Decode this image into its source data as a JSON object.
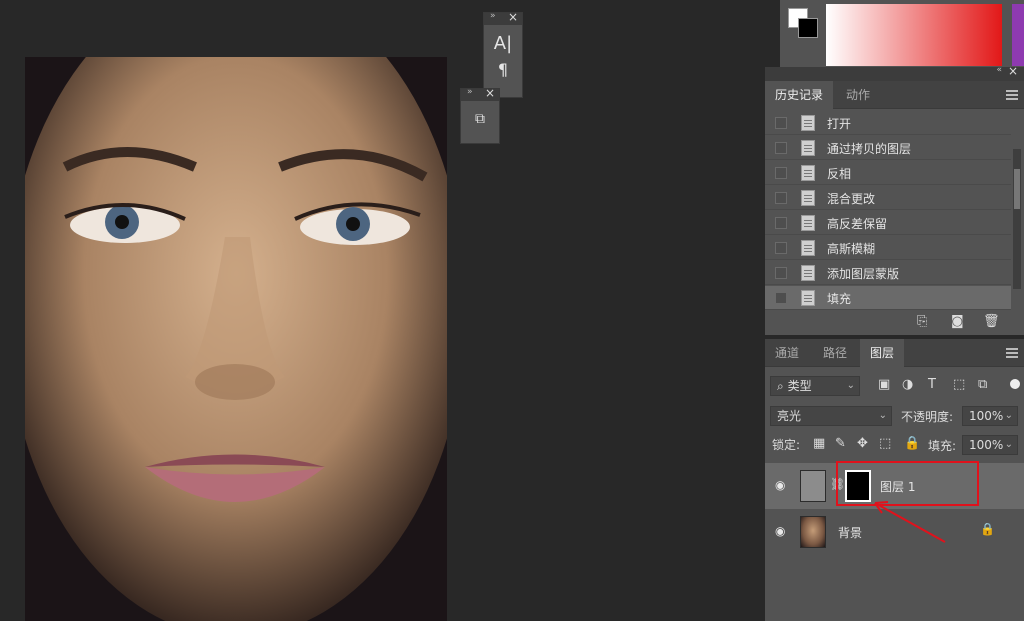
{
  "colors": {
    "background": "#282828",
    "panel": "#535353",
    "annotation": "#e0121c",
    "picker_hue": "#e21818"
  },
  "text_tools": {
    "char_icon": "A|",
    "para_icon": "¶"
  },
  "history_panel": {
    "tabs": [
      "历史记录",
      "动作"
    ],
    "items": [
      "打开",
      "通过拷贝的图层",
      "反相",
      "混合更改",
      "高反差保留",
      "高斯模糊",
      "添加图层蒙版",
      "填充"
    ],
    "icons": [
      "new-snapshot-icon",
      "camera-icon",
      "trash-icon"
    ]
  },
  "layers_panel": {
    "tabs": [
      "通道",
      "路径",
      "图层"
    ],
    "filter_kind": "类型",
    "blend_mode": "亮光",
    "opacity_label": "不透明度:",
    "opacity_value": "100%",
    "lock_label": "锁定:",
    "fill_label": "填充:",
    "fill_value": "100%",
    "layers": [
      {
        "name": "图层 1",
        "visible": true,
        "has_mask": true
      },
      {
        "name": "背景",
        "visible": true,
        "locked": true
      }
    ]
  }
}
